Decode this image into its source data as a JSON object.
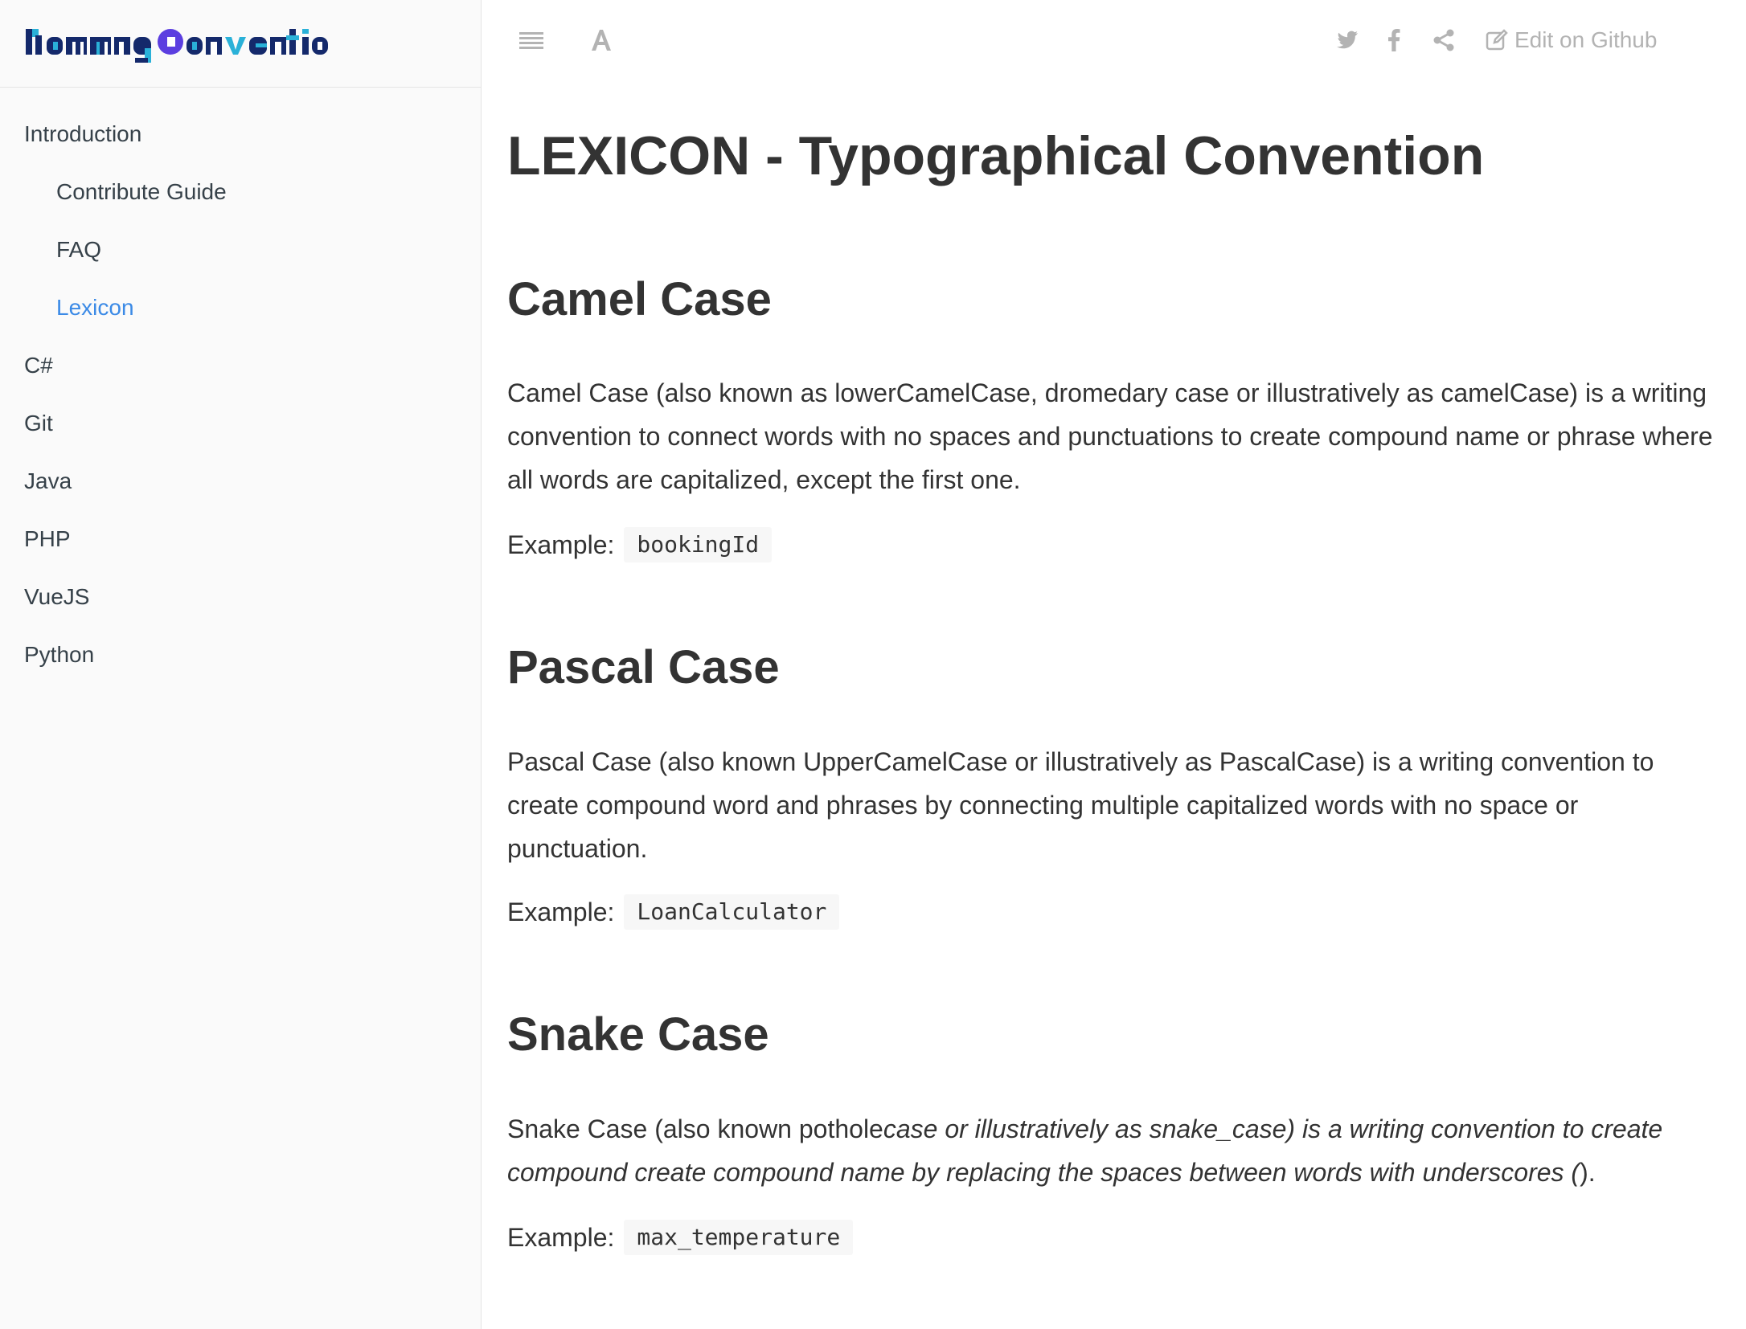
{
  "brand": {
    "logo_text": "NamingConvention"
  },
  "sidebar": {
    "items": [
      {
        "label": "Introduction",
        "level": 0,
        "active": false
      },
      {
        "label": "Contribute Guide",
        "level": 1,
        "active": false
      },
      {
        "label": "FAQ",
        "level": 1,
        "active": false
      },
      {
        "label": "Lexicon",
        "level": 1,
        "active": true
      },
      {
        "label": "C#",
        "level": 0,
        "active": false
      },
      {
        "label": "Git",
        "level": 0,
        "active": false
      },
      {
        "label": "Java",
        "level": 0,
        "active": false
      },
      {
        "label": "PHP",
        "level": 0,
        "active": false
      },
      {
        "label": "VueJS",
        "level": 0,
        "active": false
      },
      {
        "label": "Python",
        "level": 0,
        "active": false
      }
    ]
  },
  "toolbar": {
    "edit_label": "Edit on Github",
    "icons": [
      "menu-icon",
      "font-settings-icon",
      "twitter-icon",
      "facebook-icon",
      "share-icon",
      "edit-icon"
    ]
  },
  "colors": {
    "accent": "#3b8ae6",
    "icon_grey": "#b3b3b3",
    "text": "#333333",
    "sidebar_bg": "#fafafa"
  },
  "page": {
    "title": "LEXICON - Typographical Convention",
    "example_label": "Example:",
    "sections": [
      {
        "heading": "Camel Case",
        "body": "Camel Case (also known as lowerCamelCase, dromedary case or illustratively as camelCase) is a writing convention to connect words with no spaces and punctuations to create compound name or phrase where all words are capitalized, except the first one.",
        "example": "bookingId"
      },
      {
        "heading": "Pascal Case",
        "body": "Pascal Case (also known UpperCamelCase or illustratively as PascalCase) is a writing convention to create compound word and phrases by connecting multiple capitalized words with no space or punctuation.",
        "example": "LoanCalculator"
      },
      {
        "heading": "Snake Case",
        "body_plain": "Snake Case (also known pothole",
        "body_italic": "case or illustratively as snake_case) is a writing convention to create compound create compound name by replacing the spaces between words with underscores (",
        "body_end": ").",
        "example": "max_temperature"
      }
    ]
  }
}
